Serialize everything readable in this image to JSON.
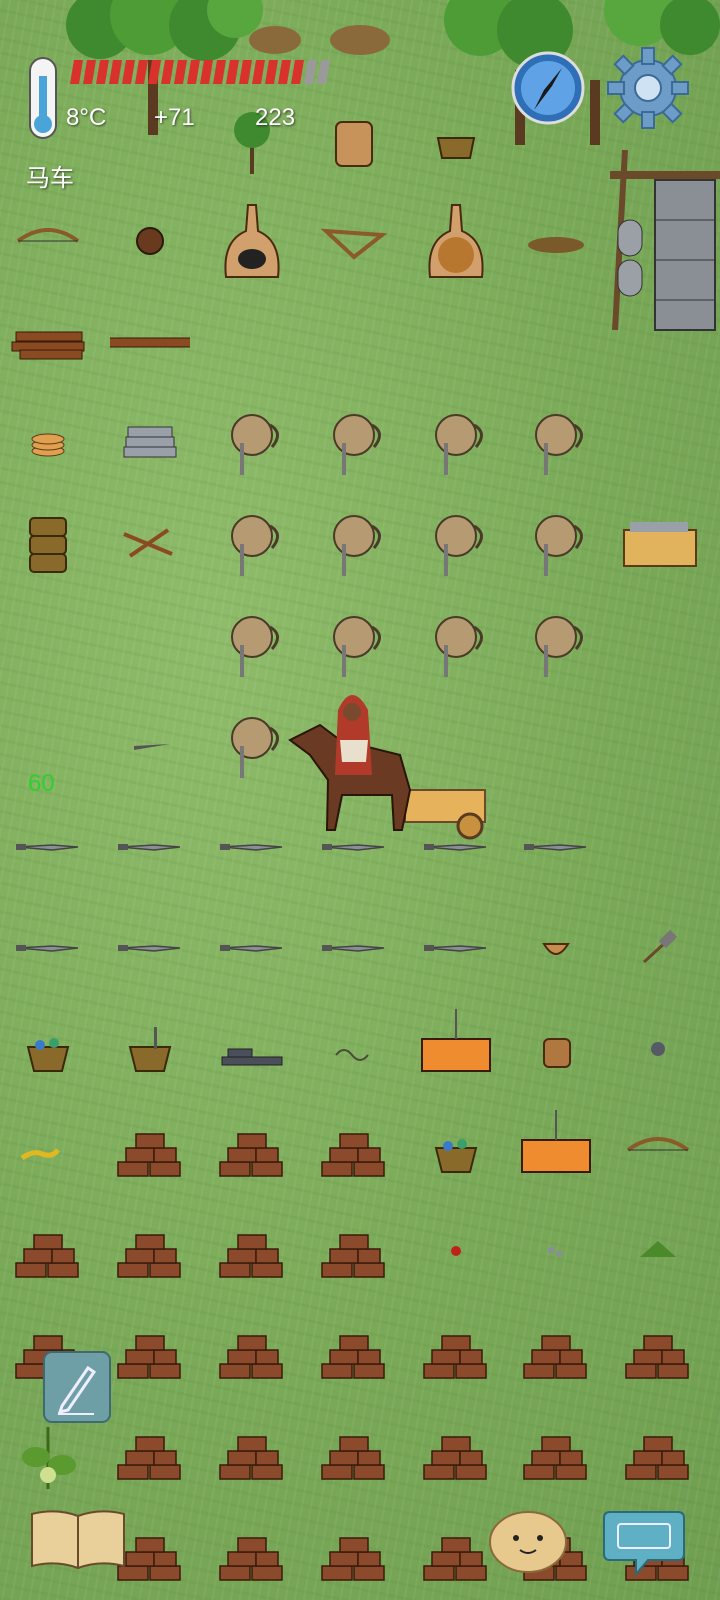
{
  "hud": {
    "temperature": "8°C",
    "food_bonus": "+71",
    "yum_count": "223",
    "held_object_label": "马车",
    "food_meter": {
      "filled": 18,
      "total": 20
    },
    "age_marker": "60"
  },
  "icons": {
    "thermometer": "thermometer-icon",
    "compass": "compass-icon",
    "settings": "gear-icon",
    "note": "pencil-note-icon",
    "recipe_book": "book-icon",
    "emote": "potato-face-icon",
    "chat": "keyboard-chat-icon"
  },
  "colors": {
    "grass": "#7aaa58",
    "food_red": "#d9312b",
    "age_green": "#2fcf2f",
    "hud_white": "#ffffff"
  },
  "world": {
    "player_object": "horse-cart",
    "tiles": [
      {
        "r": 0,
        "c": 2,
        "k": "sapling"
      },
      {
        "r": 0,
        "c": 3,
        "k": "clay-crock"
      },
      {
        "r": 0,
        "c": 4,
        "k": "basket"
      },
      {
        "r": 1,
        "c": 0,
        "k": "bow"
      },
      {
        "r": 1,
        "c": 1,
        "k": "burdock"
      },
      {
        "r": 1,
        "c": 2,
        "k": "kiln"
      },
      {
        "r": 1,
        "c": 3,
        "k": "bow-drill"
      },
      {
        "r": 1,
        "c": 4,
        "k": "kiln-clay"
      },
      {
        "r": 1,
        "c": 5,
        "k": "kindling"
      },
      {
        "r": 2,
        "c": 0,
        "k": "firewood"
      },
      {
        "r": 2,
        "c": 1,
        "k": "long-shaft"
      },
      {
        "r": 3,
        "c": 0,
        "k": "plates"
      },
      {
        "r": 3,
        "c": 1,
        "k": "flat-stones"
      },
      {
        "r": 3,
        "c": 2,
        "k": "sheep-pelt"
      },
      {
        "r": 3,
        "c": 3,
        "k": "sheep-pelt"
      },
      {
        "r": 3,
        "c": 4,
        "k": "sheep-pelt"
      },
      {
        "r": 3,
        "c": 5,
        "k": "sheep-pelt"
      },
      {
        "r": 4,
        "c": 0,
        "k": "stacked-baskets"
      },
      {
        "r": 4,
        "c": 1,
        "k": "crossed-sticks"
      },
      {
        "r": 4,
        "c": 2,
        "k": "sheep-pelt"
      },
      {
        "r": 4,
        "c": 3,
        "k": "sheep-pelt"
      },
      {
        "r": 4,
        "c": 4,
        "k": "sheep-pelt"
      },
      {
        "r": 4,
        "c": 5,
        "k": "sheep-pelt"
      },
      {
        "r": 4,
        "c": 6,
        "k": "wood-crate"
      },
      {
        "r": 5,
        "c": 2,
        "k": "sheep-pelt"
      },
      {
        "r": 5,
        "c": 3,
        "k": "sheep-pelt"
      },
      {
        "r": 5,
        "c": 4,
        "k": "sheep-pelt"
      },
      {
        "r": 5,
        "c": 5,
        "k": "sheep-pelt"
      },
      {
        "r": 6,
        "c": 1,
        "k": "small-blade"
      },
      {
        "r": 6,
        "c": 2,
        "k": "sheep-pelt"
      },
      {
        "r": 7,
        "c": 0,
        "k": "knife"
      },
      {
        "r": 7,
        "c": 1,
        "k": "knife"
      },
      {
        "r": 7,
        "c": 2,
        "k": "knife"
      },
      {
        "r": 7,
        "c": 3,
        "k": "knife"
      },
      {
        "r": 7,
        "c": 4,
        "k": "knife"
      },
      {
        "r": 7,
        "c": 5,
        "k": "knife"
      },
      {
        "r": 8,
        "c": 0,
        "k": "knife"
      },
      {
        "r": 8,
        "c": 1,
        "k": "knife"
      },
      {
        "r": 8,
        "c": 2,
        "k": "knife"
      },
      {
        "r": 8,
        "c": 3,
        "k": "knife"
      },
      {
        "r": 8,
        "c": 4,
        "k": "knife"
      },
      {
        "r": 8,
        "c": 5,
        "k": "bowl"
      },
      {
        "r": 8,
        "c": 6,
        "k": "hammer"
      },
      {
        "r": 9,
        "c": 0,
        "k": "berry-basket"
      },
      {
        "r": 9,
        "c": 1,
        "k": "tool-basket"
      },
      {
        "r": 9,
        "c": 2,
        "k": "steel-ingots"
      },
      {
        "r": 9,
        "c": 3,
        "k": "rope"
      },
      {
        "r": 9,
        "c": 4,
        "k": "newcomen-engine"
      },
      {
        "r": 9,
        "c": 5,
        "k": "crock"
      },
      {
        "r": 9,
        "c": 6,
        "k": "stone-ball"
      },
      {
        "r": 10,
        "c": 0,
        "k": "yellow-worm"
      },
      {
        "r": 10,
        "c": 1,
        "k": "adobe-bricks"
      },
      {
        "r": 10,
        "c": 2,
        "k": "adobe-bricks"
      },
      {
        "r": 10,
        "c": 3,
        "k": "adobe-bricks"
      },
      {
        "r": 10,
        "c": 4,
        "k": "berry-basket"
      },
      {
        "r": 10,
        "c": 5,
        "k": "newcomen-engine"
      },
      {
        "r": 10,
        "c": 6,
        "k": "bow"
      },
      {
        "r": 11,
        "c": 0,
        "k": "adobe-bricks"
      },
      {
        "r": 11,
        "c": 1,
        "k": "adobe-bricks"
      },
      {
        "r": 11,
        "c": 2,
        "k": "adobe-bricks"
      },
      {
        "r": 11,
        "c": 3,
        "k": "adobe-bricks"
      },
      {
        "r": 11,
        "c": 4,
        "k": "red-berry"
      },
      {
        "r": 11,
        "c": 5,
        "k": "flint-chips"
      },
      {
        "r": 11,
        "c": 6,
        "k": "leaf-pile"
      },
      {
        "r": 12,
        "c": 0,
        "k": "adobe-bricks"
      },
      {
        "r": 12,
        "c": 1,
        "k": "adobe-bricks"
      },
      {
        "r": 12,
        "c": 2,
        "k": "adobe-bricks"
      },
      {
        "r": 12,
        "c": 3,
        "k": "adobe-bricks"
      },
      {
        "r": 12,
        "c": 4,
        "k": "adobe-bricks"
      },
      {
        "r": 12,
        "c": 5,
        "k": "adobe-bricks"
      },
      {
        "r": 12,
        "c": 6,
        "k": "adobe-bricks"
      },
      {
        "r": 13,
        "c": 0,
        "k": "squash-plant"
      },
      {
        "r": 13,
        "c": 1,
        "k": "adobe-bricks"
      },
      {
        "r": 13,
        "c": 2,
        "k": "adobe-bricks"
      },
      {
        "r": 13,
        "c": 3,
        "k": "adobe-bricks"
      },
      {
        "r": 13,
        "c": 4,
        "k": "adobe-bricks"
      },
      {
        "r": 13,
        "c": 5,
        "k": "adobe-bricks"
      },
      {
        "r": 13,
        "c": 6,
        "k": "adobe-bricks"
      },
      {
        "r": 14,
        "c": 1,
        "k": "adobe-bricks"
      },
      {
        "r": 14,
        "c": 2,
        "k": "adobe-bricks"
      },
      {
        "r": 14,
        "c": 3,
        "k": "adobe-bricks"
      },
      {
        "r": 14,
        "c": 4,
        "k": "adobe-bricks"
      },
      {
        "r": 14,
        "c": 5,
        "k": "adobe-bricks"
      },
      {
        "r": 14,
        "c": 6,
        "k": "adobe-bricks"
      }
    ]
  }
}
